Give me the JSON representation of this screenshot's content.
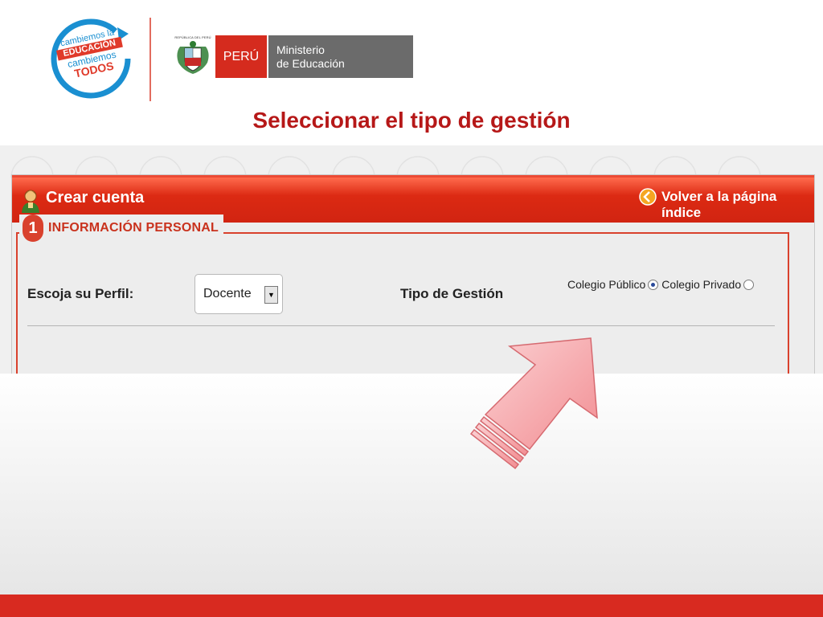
{
  "logo": {
    "line1": "cambiemos la",
    "line2": "EDUCACIÓN",
    "line3": "cambiemos",
    "line4": "TODOS"
  },
  "ministry": {
    "shield_caption": "REPÚBLICA DEL PERÚ",
    "country": "PERÚ",
    "line1": "Ministerio",
    "line2": "de Educación"
  },
  "slide_title": "Seleccionar el tipo de gestión",
  "window": {
    "title": "Crear cuenta",
    "back_link": "Volver a la página índice"
  },
  "section": {
    "number": "1",
    "title": "INFORMACIÓN PERSONAL"
  },
  "form": {
    "perfil_label": "Escoja su Perfil:",
    "perfil_value": "Docente",
    "gestion_label": "Tipo de Gestión",
    "options": [
      {
        "label": "Colegio Público",
        "selected": true
      },
      {
        "label": "Colegio Privado",
        "selected": false
      }
    ]
  },
  "colors": {
    "accent_red": "#d82a20",
    "title_red": "#b61818",
    "header_red": "#dc2a13",
    "arrow_pink": "#f7a3a6",
    "logo_blue": "#1a8fd1"
  }
}
